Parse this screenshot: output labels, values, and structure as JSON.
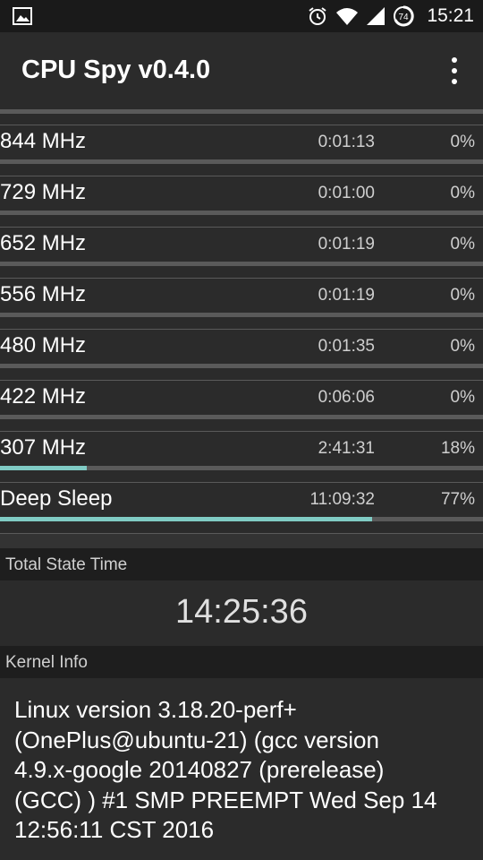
{
  "status_bar": {
    "left_icon": "image-icon",
    "icons": [
      "alarm-icon",
      "wifi-icon",
      "signal-icon",
      "battery-icon"
    ],
    "battery_level": "74",
    "time": "15:21"
  },
  "app_bar": {
    "title": "CPU Spy v0.4.0",
    "menu_icon": "overflow-menu-icon"
  },
  "states": [
    {
      "name": "844 MHz",
      "time": "0:01:13",
      "percent": "0%",
      "fraction": 0.0
    },
    {
      "name": "729 MHz",
      "time": "0:01:00",
      "percent": "0%",
      "fraction": 0.0
    },
    {
      "name": "652 MHz",
      "time": "0:01:19",
      "percent": "0%",
      "fraction": 0.0
    },
    {
      "name": "556 MHz",
      "time": "0:01:19",
      "percent": "0%",
      "fraction": 0.0
    },
    {
      "name": "480 MHz",
      "time": "0:01:35",
      "percent": "0%",
      "fraction": 0.0
    },
    {
      "name": "422 MHz",
      "time": "0:06:06",
      "percent": "0%",
      "fraction": 0.0
    },
    {
      "name": "307 MHz",
      "time": "2:41:31",
      "percent": "18%",
      "fraction": 0.18
    },
    {
      "name": "Deep Sleep",
      "time": "11:09:32",
      "percent": "77%",
      "fraction": 0.77
    }
  ],
  "colors": {
    "progress_fill": "#80cbc4",
    "progress_track": "#5a5a5a"
  },
  "total_state": {
    "header": "Total State Time",
    "value": "14:25:36"
  },
  "kernel": {
    "header": "Kernel Info",
    "lines": [
      "Linux version 3.18.20-perf+",
      "(OnePlus@ubuntu-21) (gcc version",
      "4.9.x-google 20140827 (prerelease)",
      "(GCC) ) #1 SMP PREEMPT Wed Sep 14",
      "12:56:11 CST 2016"
    ]
  }
}
